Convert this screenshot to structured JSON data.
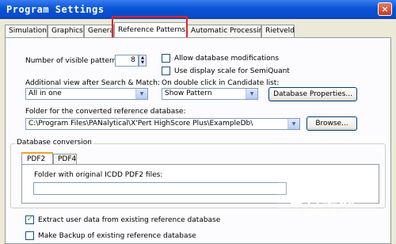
{
  "window": {
    "title": "Program Settings",
    "close_glyph": "×"
  },
  "tabs": [
    "Simulation",
    "Graphics",
    "General",
    "Reference Patterns",
    "Automatic Processing",
    "Rietveld"
  ],
  "visible_patterns": {
    "label": "Number of visible patterns:",
    "value": "8"
  },
  "allow_db_mod": {
    "label": "Allow database modifications",
    "checked": false
  },
  "use_display_scale": {
    "label": "Use display scale for SemiQuant",
    "checked": false
  },
  "additional_view": {
    "label": "Additional view after Search & Match:",
    "value": "All in one"
  },
  "double_click": {
    "label": "On double click in Candidate list:",
    "value": "Show Pattern"
  },
  "db_properties_button": "Database Properties...",
  "folder": {
    "label": "Folder for the converted reference database:",
    "value": "C:\\Program Files\\PANalytical\\X'Pert HighScore Plus\\ExampleDb\\"
  },
  "browse_button": "Browse...",
  "db_conversion": {
    "title": "Database conversion",
    "tabs": [
      "PDF2",
      "PDF4"
    ],
    "folder_label": "Folder with original ICDD PDF2 files:",
    "folder_value": ""
  },
  "extract_user_data": {
    "label": "Extract user data from existing reference database",
    "checked": true
  },
  "make_backup": {
    "label": "Make Backup of existing reference database",
    "checked": false
  },
  "watermark": {
    "title": "百科全说",
    "subtitle": "助你轻松解决"
  }
}
